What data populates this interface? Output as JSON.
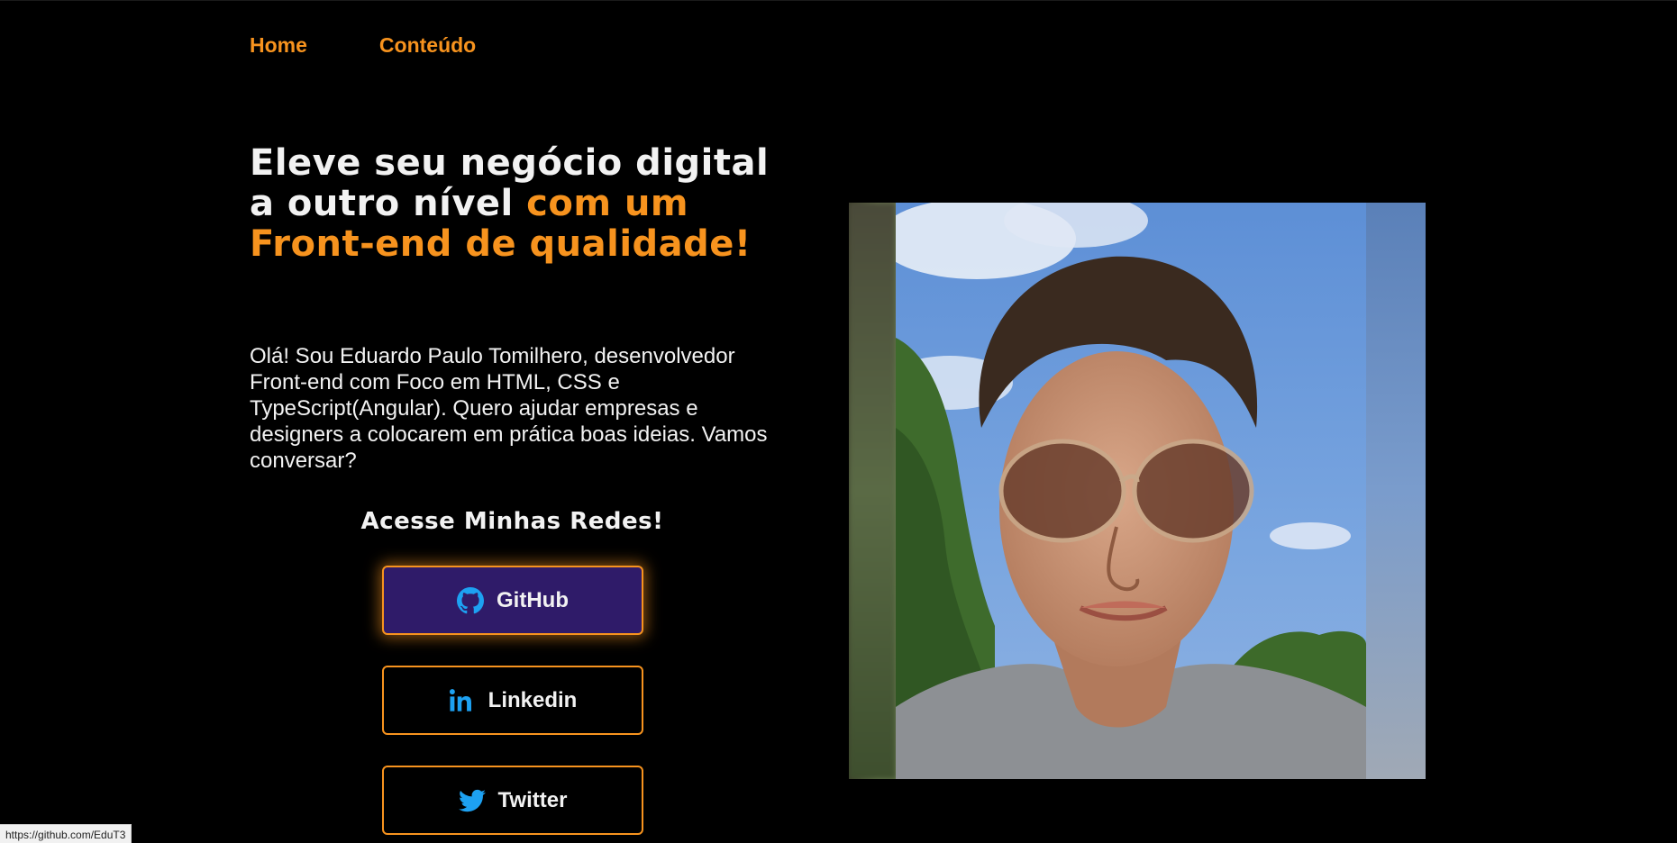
{
  "nav": {
    "items": [
      {
        "label": "Home"
      },
      {
        "label": "Conteúdo"
      }
    ]
  },
  "hero": {
    "title_plain": "Eleve seu negócio digital a outro nível ",
    "title_accent": "com um Front-end de qualidade!",
    "description": "Olá! Sou Eduardo Paulo Tomilhero, desenvolvedor Front-end com Foco em HTML, CSS e TypeScript(Angular). Quero ajudar empresas e designers a colocarem em prática boas ideias. Vamos conversar?"
  },
  "social": {
    "heading": "Acesse Minhas Redes!",
    "buttons": [
      {
        "label": "GitHub",
        "icon": "github-icon",
        "active": true
      },
      {
        "label": "Linkedin",
        "icon": "linkedin-icon",
        "active": false
      },
      {
        "label": "Twitter",
        "icon": "twitter-icon",
        "active": false
      }
    ]
  },
  "photo": {
    "alt": "profile-photo"
  },
  "status_bar": {
    "url": "https://github.com/EduT3"
  },
  "colors": {
    "background": "#000000",
    "accent": "#f7931e",
    "text": "#f2f2f2",
    "active_button": "#2f1b69",
    "icon": "#1da1f2"
  }
}
